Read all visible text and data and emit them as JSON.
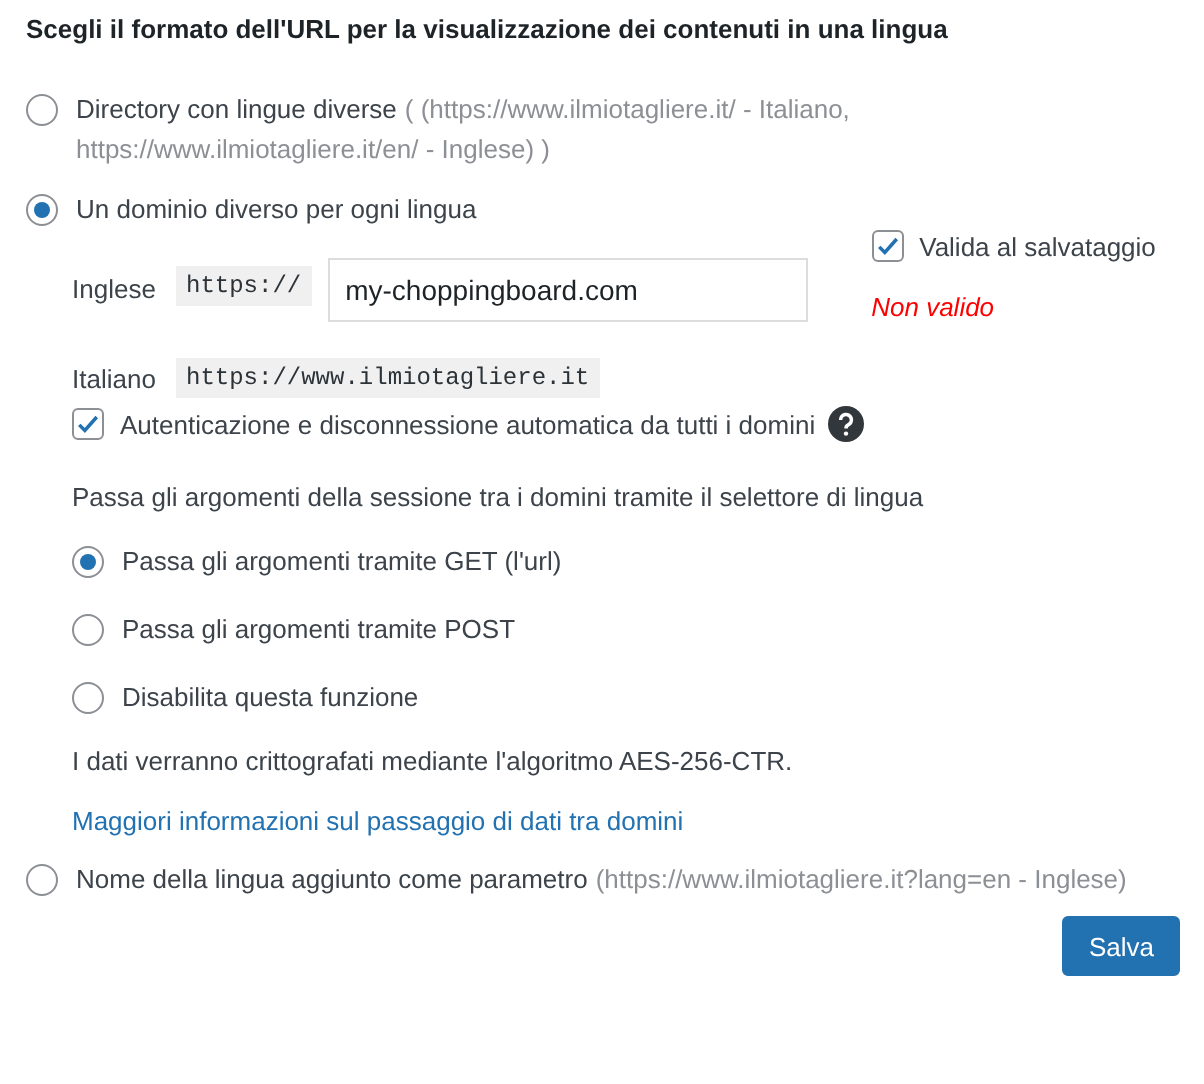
{
  "heading": "Scegli il formato dell'URL per la visualizzazione dei contenuti in una lingua",
  "url_formats": [
    {
      "kind": "plain",
      "label": "Directory con lingue diverse",
      "hint": "( (https://www.ilmiotagliere.it/ - Italiano, https://www.ilmiotagliere.it/en/ - Inglese) )",
      "selected": false
    },
    {
      "kind": "domains",
      "label": "Un dominio diverso per ogni lingua",
      "selected": true
    },
    {
      "kind": "plain",
      "label": "Nome della lingua aggiunto come parametro",
      "hint": "(https://www.ilmiotagliere.it?lang=en - Inglese)",
      "selected": false
    }
  ],
  "domains": {
    "editable": {
      "language": "Inglese",
      "prefix": "https://",
      "value": "my-choppingboard.com",
      "validate": {
        "label": "Valida al salvataggio",
        "checked": true
      },
      "error": "Non valido"
    },
    "fixed": {
      "language": "Italiano",
      "url": "https://www.ilmiotagliere.it"
    },
    "auto_login": {
      "label": "Autenticazione e disconnessione automatica da tutti i domini",
      "checked": true
    },
    "session_label": "Passa gli argomenti della sessione tra i domini tramite il selettore di lingua",
    "session_options": [
      {
        "label": "Passa gli argomenti tramite GET (l'url)",
        "selected": true
      },
      {
        "label": "Passa gli argomenti tramite POST",
        "selected": false
      },
      {
        "label": "Disabilita questa funzione",
        "selected": false
      }
    ],
    "note": "I dati verranno crittografati mediante l'algoritmo AES-256-CTR.",
    "link": "Maggiori informazioni sul passaggio di dati tra domini"
  },
  "save_button": "Salva"
}
